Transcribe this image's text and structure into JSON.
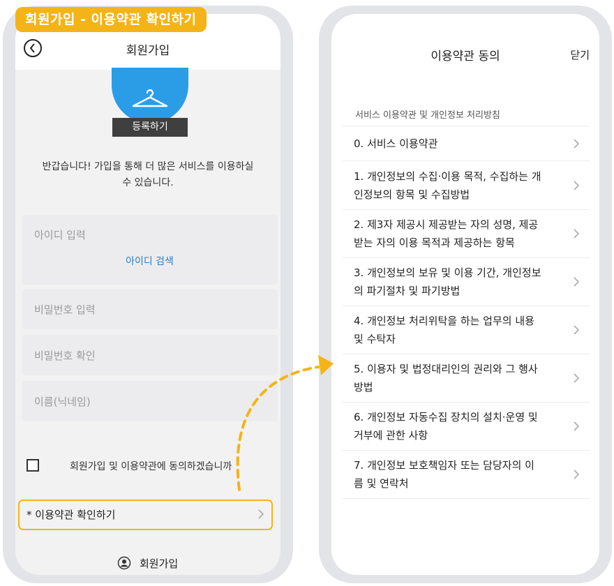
{
  "caption": "회원가입 - 이용약관 확인하기",
  "left_screen": {
    "header_title": "회원가입",
    "back_icon": "chevron-left-circle-icon",
    "hero_icon": "hanger-icon",
    "register_badge": "등록하기",
    "welcome_line1": "반갑습니다! 가입을 통해 더 많은 서비스를 이용하실",
    "welcome_line2": "수 있습니다.",
    "fields": {
      "id_placeholder": "아이디 입력",
      "id_search": "아이디 검색",
      "pw_placeholder": "비밀번호 입력",
      "pw_confirm_placeholder": "비밀번호 확인",
      "name_placeholder": "이름(닉네임)"
    },
    "agree_label": "회원가입 및 이용약관에 동의하겠습니까",
    "terms_link": "* 이용약관 확인하기",
    "footer_label": "회원가입"
  },
  "right_screen": {
    "title": "이용약관 동의",
    "close": "닫기",
    "section_header": "서비스 이용약관 및 개인정보 처리방침",
    "terms": [
      {
        "line1": "0. 서비스 이용약관",
        "line2": ""
      },
      {
        "line1": "1. 개인정보의 수집·이용 목적, 수집하는 개",
        "line2": "인정보의 항목 및 수집방법"
      },
      {
        "line1": "2. 제3자 제공시 제공받는 자의 성명, 제공",
        "line2": "받는 자의 이용 목적과 제공하는 항목"
      },
      {
        "line1": "3. 개인정보의 보유 및 이용 기간, 개인정보",
        "line2": "의 파기절차 및 파기방법"
      },
      {
        "line1": "4. 개인정보 처리위탁을 하는 업무의 내용",
        "line2": "및 수탁자"
      },
      {
        "line1": "5. 이용자 및 법정대리인의 권리와 그 행사",
        "line2": "방법"
      },
      {
        "line1": "6. 개인정보 자동수집 장치의 설치·운영 및",
        "line2": "거부에 관한 사항"
      },
      {
        "line1": "7. 개인정보 보호책임자 또는 담당자의 이",
        "line2": "름 및 연락처"
      }
    ]
  },
  "colors": {
    "accent": "#f4b417",
    "hero_blue": "#2b9de6",
    "link_blue": "#2a7fc9",
    "frame": "#e3e4e8"
  }
}
